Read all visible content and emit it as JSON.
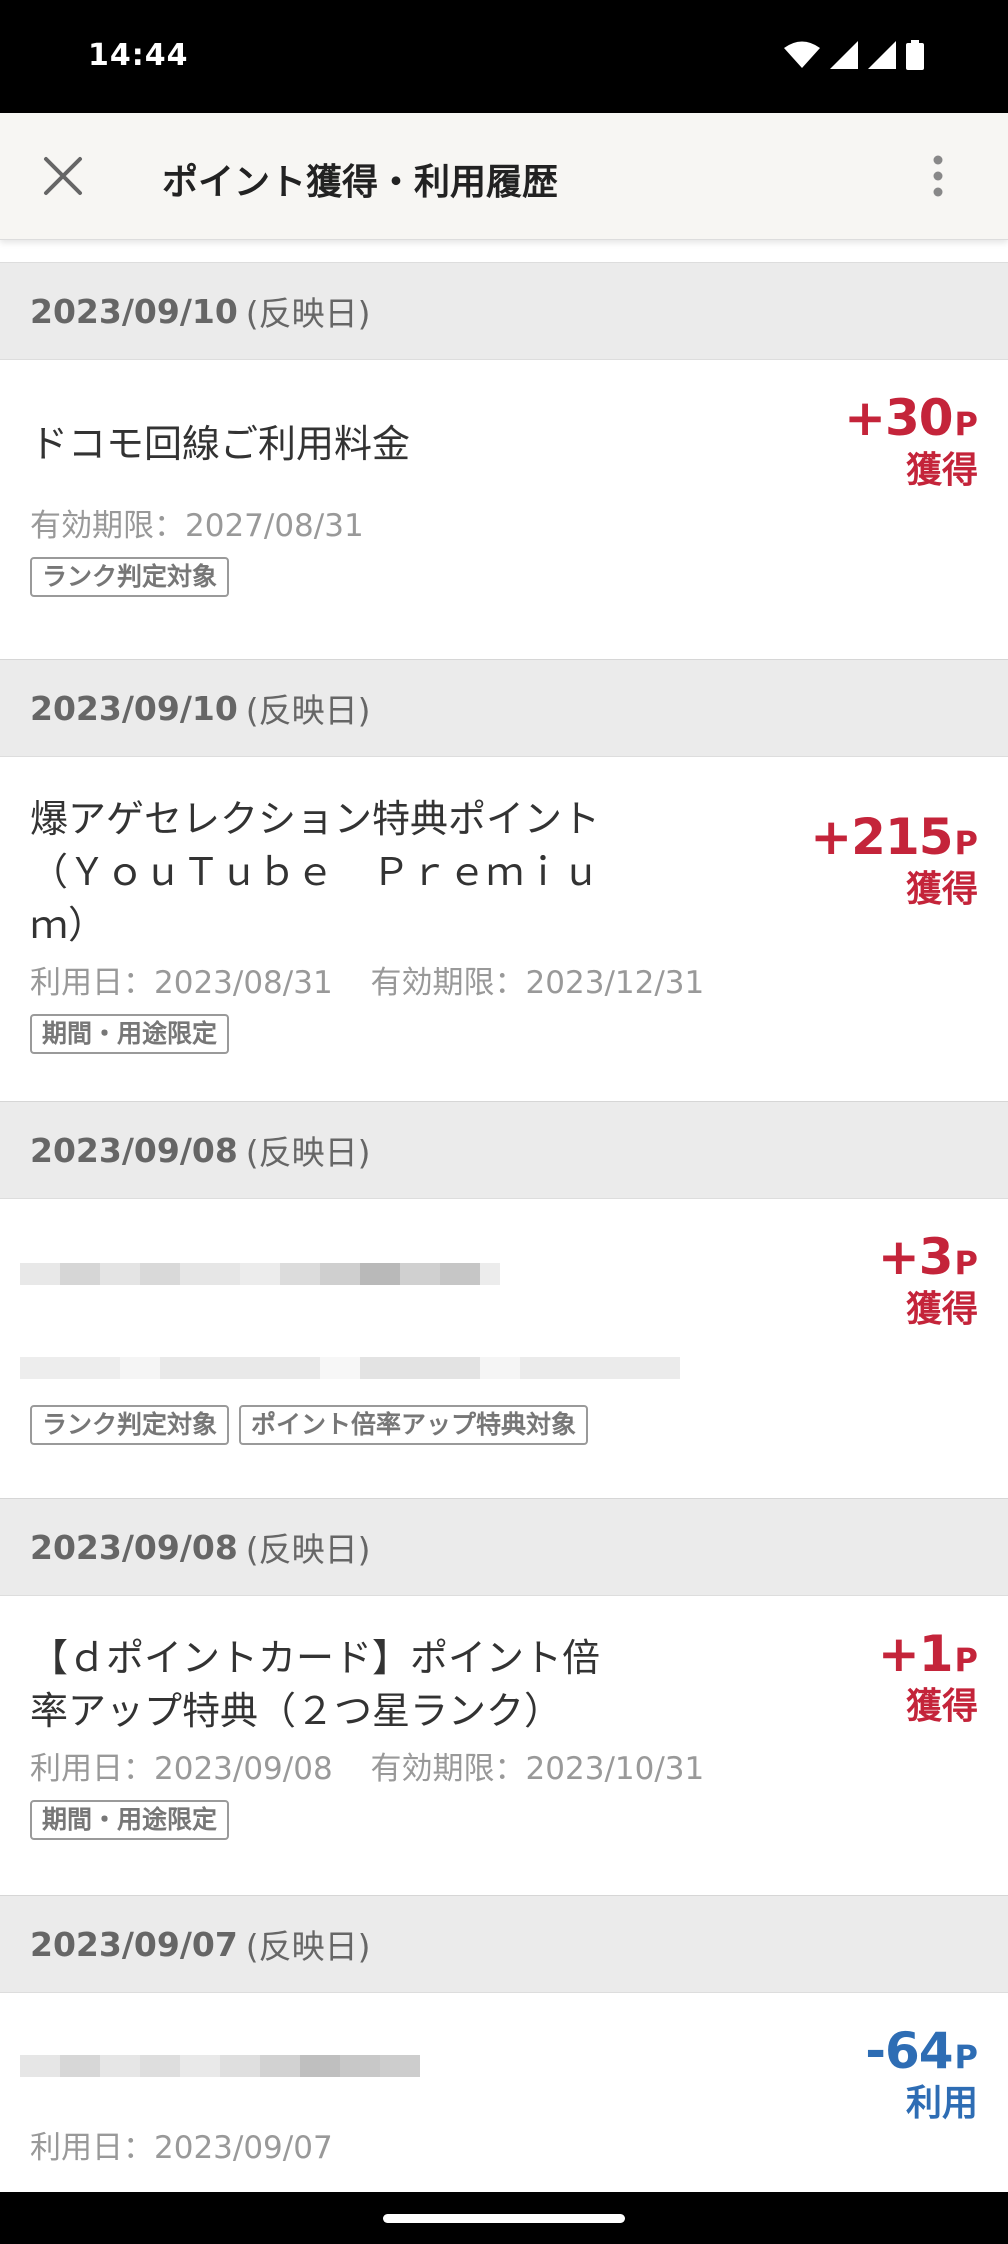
{
  "status_bar": {
    "time": "14:44"
  },
  "app_bar": {
    "title": "ポイント獲得・利用履歴"
  },
  "sections": [
    {
      "date": "2023/09/10",
      "date_suffix": "(反映日)",
      "title": "ドコモ回線ご利用料金",
      "meta": [
        "有効期限：2027/08/31"
      ],
      "badges": [
        "ランク判定対象"
      ],
      "amount": "+30",
      "unit": "P",
      "kind": "獲得"
    },
    {
      "date": "2023/09/10",
      "date_suffix": "(反映日)",
      "title": "爆アゲセレクション特典ポイント（ＹｏｕＴｕｂｅ　Ｐｒｅｍｉｕｍ）",
      "meta": [
        "利用日：2023/08/31",
        "有効期限：2023/12/31"
      ],
      "badges": [
        "期間・用途限定"
      ],
      "amount": "+215",
      "unit": "P",
      "kind": "獲得"
    },
    {
      "date": "2023/09/08",
      "date_suffix": "(反映日)",
      "title": "",
      "meta": [],
      "badges": [
        "ランク判定対象",
        "ポイント倍率アップ特典対象"
      ],
      "amount": "+3",
      "unit": "P",
      "kind": "獲得"
    },
    {
      "date": "2023/09/08",
      "date_suffix": "(反映日)",
      "title": "【ｄポイントカード】ポイント倍率アップ特典（２つ星ランク）",
      "meta": [
        "利用日：2023/09/08",
        "有効期限：2023/10/31"
      ],
      "badges": [
        "期間・用途限定"
      ],
      "amount": "+1",
      "unit": "P",
      "kind": "獲得"
    },
    {
      "date": "2023/09/07",
      "date_suffix": "(反映日)",
      "title": "",
      "meta": [
        "利用日：2023/09/07"
      ],
      "badges": [],
      "amount": "-64",
      "unit": "P",
      "kind": "利用"
    }
  ],
  "colors": {
    "earn": "#c4243a",
    "use": "#2e6db4",
    "header_bg": "#ebebeb"
  },
  "icons": [
    "wifi-icon",
    "signal-icon",
    "battery-icon",
    "close-icon",
    "more-vert-icon"
  ]
}
